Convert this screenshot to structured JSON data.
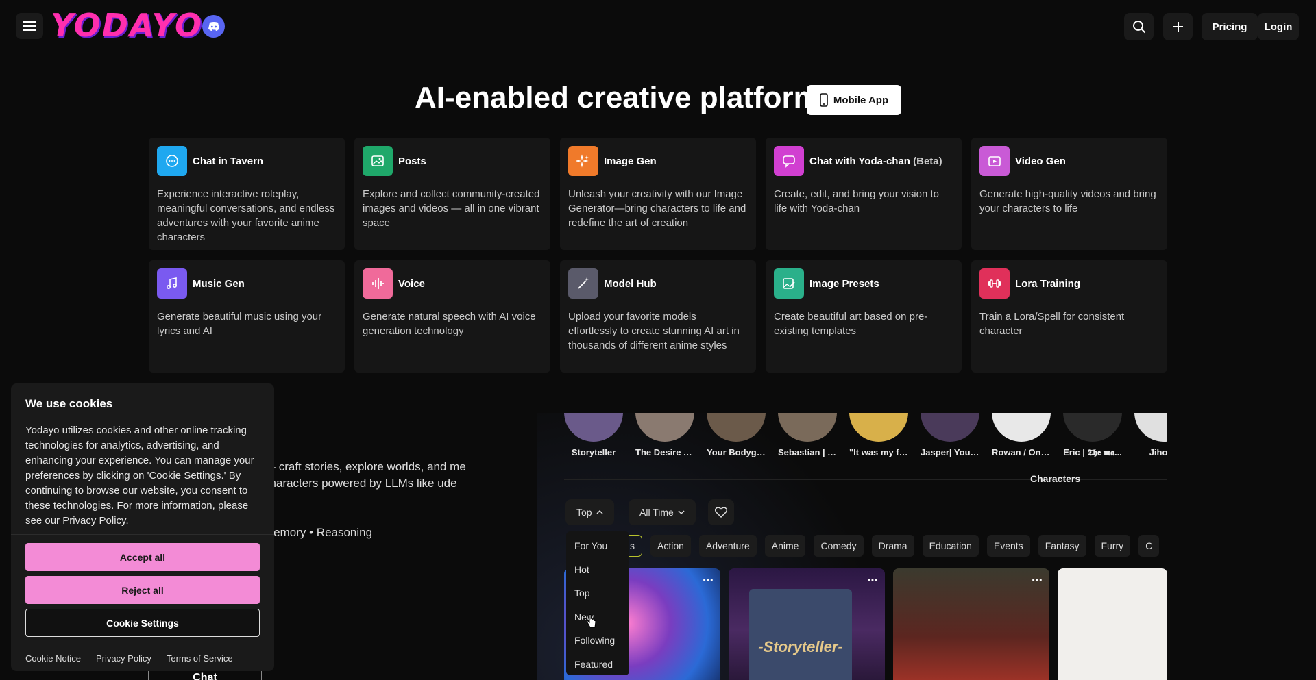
{
  "header": {
    "logo_text": "YODAYO",
    "pricing_label": "Pricing",
    "login_label": "Login"
  },
  "hero": {
    "title": "AI-enabled creative platform",
    "mobile_app_label": "Mobile App"
  },
  "features": [
    {
      "title": "Chat in Tavern",
      "desc": "Experience interactive roleplay, meaningful conversations, and endless adventures with your favorite anime characters",
      "color": "#1fa8f0",
      "icon": "chat-bubble-icon"
    },
    {
      "title": "Posts",
      "desc": "Explore and collect community-created images and videos — all in one vibrant space",
      "color": "#1fa86a",
      "icon": "image-icon"
    },
    {
      "title": "Image Gen",
      "desc": "Unleash your creativity with our Image Generator—bring characters to life and redefine the art of creation",
      "color": "#f07a2a",
      "icon": "sparkles-icon"
    },
    {
      "title": "Chat with Yoda-chan",
      "title_suffix": "(Beta)",
      "desc": "Create, edit, and bring your vision to life with Yoda-chan",
      "color": "#d13fd1",
      "icon": "message-square-icon"
    },
    {
      "title": "Video Gen",
      "desc": "Generate high-quality videos and bring your characters to life",
      "color": "#c95ad6",
      "icon": "video-icon"
    },
    {
      "title": "Music Gen",
      "desc": "Generate beautiful music using your lyrics and AI",
      "color": "#7a5af0",
      "icon": "music-note-icon"
    },
    {
      "title": "Voice",
      "desc": "Generate natural speech with AI voice generation technology",
      "color": "#f06a9a",
      "icon": "audio-waves-icon"
    },
    {
      "title": "Model Hub",
      "desc": "Upload your favorite models effortlessly to create stunning AI art in thousands of different anime styles",
      "color": "#5a5a6a",
      "icon": "magic-wand-icon"
    },
    {
      "title": "Image Presets",
      "desc": "Create beautiful art based on pre-existing templates",
      "color": "#2ab08a",
      "icon": "image-edit-icon"
    },
    {
      "title": "Lora Training",
      "desc": "Train a Lora/Spell for consistent character",
      "color": "#e0305a",
      "icon": "dumbbell-icon"
    }
  ],
  "lower": {
    "text": "— craft stories, explore worlds, and me characters powered by LLMs like ude",
    "tags_line": "Memory • Reasoning",
    "chat_button": "Chat"
  },
  "preview": {
    "avatars": [
      {
        "name": "Storyteller",
        "color": "#6a5a8a"
      },
      {
        "name": "The Desire A...",
        "color": "#8a7a70"
      },
      {
        "name": "Your Bodygu...",
        "color": "#6b5a4a"
      },
      {
        "name": "Sebastian | Y...",
        "color": "#7a6a5a"
      },
      {
        "name": "\"It was my fi...",
        "color": "#d8b04a"
      },
      {
        "name": "Jasper| Your...",
        "color": "#4a3a5a"
      },
      {
        "name": "Rowan / One...",
        "color": "#e8e8e8"
      },
      {
        "name": "Eric | 𝕿𝖍𝖊 𝖒𝖆...",
        "color": "#2a2a2a"
      },
      {
        "name": "Jihoon",
        "color": "#e0e0e0"
      }
    ],
    "section_title": "Characters",
    "filter_top": "Top",
    "filter_time": "All Time",
    "tags": [
      "s",
      "Action",
      "Adventure",
      "Anime",
      "Comedy",
      "Drama",
      "Education",
      "Events",
      "Fantasy",
      "Furry",
      "C"
    ],
    "storyteller_text": "-Storyteller-",
    "dropdown": [
      "For You",
      "Hot",
      "Top",
      "New",
      "Following",
      "Featured"
    ]
  },
  "cookie": {
    "title": "We use cookies",
    "body": "Yodayo utilizes cookies and other online tracking technologies for analytics, advertising, and enhancing your experience. You can manage your preferences by clicking on 'Cookie Settings.' By continuing to browse our website, you consent to these technologies. For more information, please see our Privacy Policy.",
    "accept": "Accept all",
    "reject": "Reject all",
    "settings": "Cookie Settings",
    "links": [
      "Cookie Notice",
      "Privacy Policy",
      "Terms of Service"
    ]
  }
}
